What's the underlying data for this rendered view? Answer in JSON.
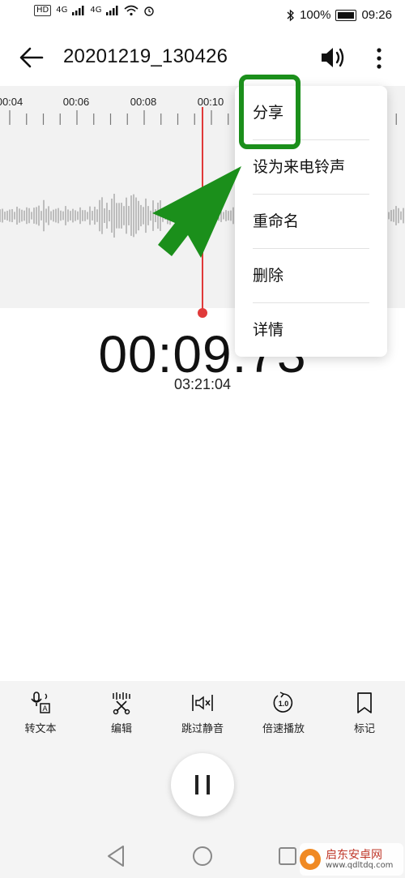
{
  "status_bar": {
    "left_indicators": [
      "HD",
      "4G",
      "4G"
    ],
    "battery": "100%",
    "time": "09:26"
  },
  "app_bar": {
    "title": "20201219_130426",
    "icons": [
      "back-arrow-icon",
      "speaker-icon",
      "more-vertical-icon"
    ]
  },
  "timeline": {
    "labels": [
      "00:04",
      "00:06",
      "00:08",
      "00:10"
    ]
  },
  "playback": {
    "current_time": "00:09.73",
    "total_time": "03:21:04"
  },
  "menu": {
    "items": [
      "分享",
      "设为来电铃声",
      "重命名",
      "删除",
      "详情"
    ]
  },
  "toolbar": {
    "items": [
      {
        "label": "转文本",
        "icon": "speech-to-text-icon"
      },
      {
        "label": "编辑",
        "icon": "edit-scissors-icon"
      },
      {
        "label": "跳过静音",
        "icon": "skip-silence-icon"
      },
      {
        "label": "倍速播放",
        "icon": "speed-icon",
        "icon_text": "1.0"
      },
      {
        "label": "标记",
        "icon": "bookmark-icon"
      }
    ]
  },
  "watermark": {
    "name": "启东安卓网",
    "url": "www.qdltdq.com"
  },
  "colors": {
    "accent_red": "#e03a3a",
    "highlight_green": "#1b8f1b",
    "panel_gray": "#f2f2f2"
  }
}
